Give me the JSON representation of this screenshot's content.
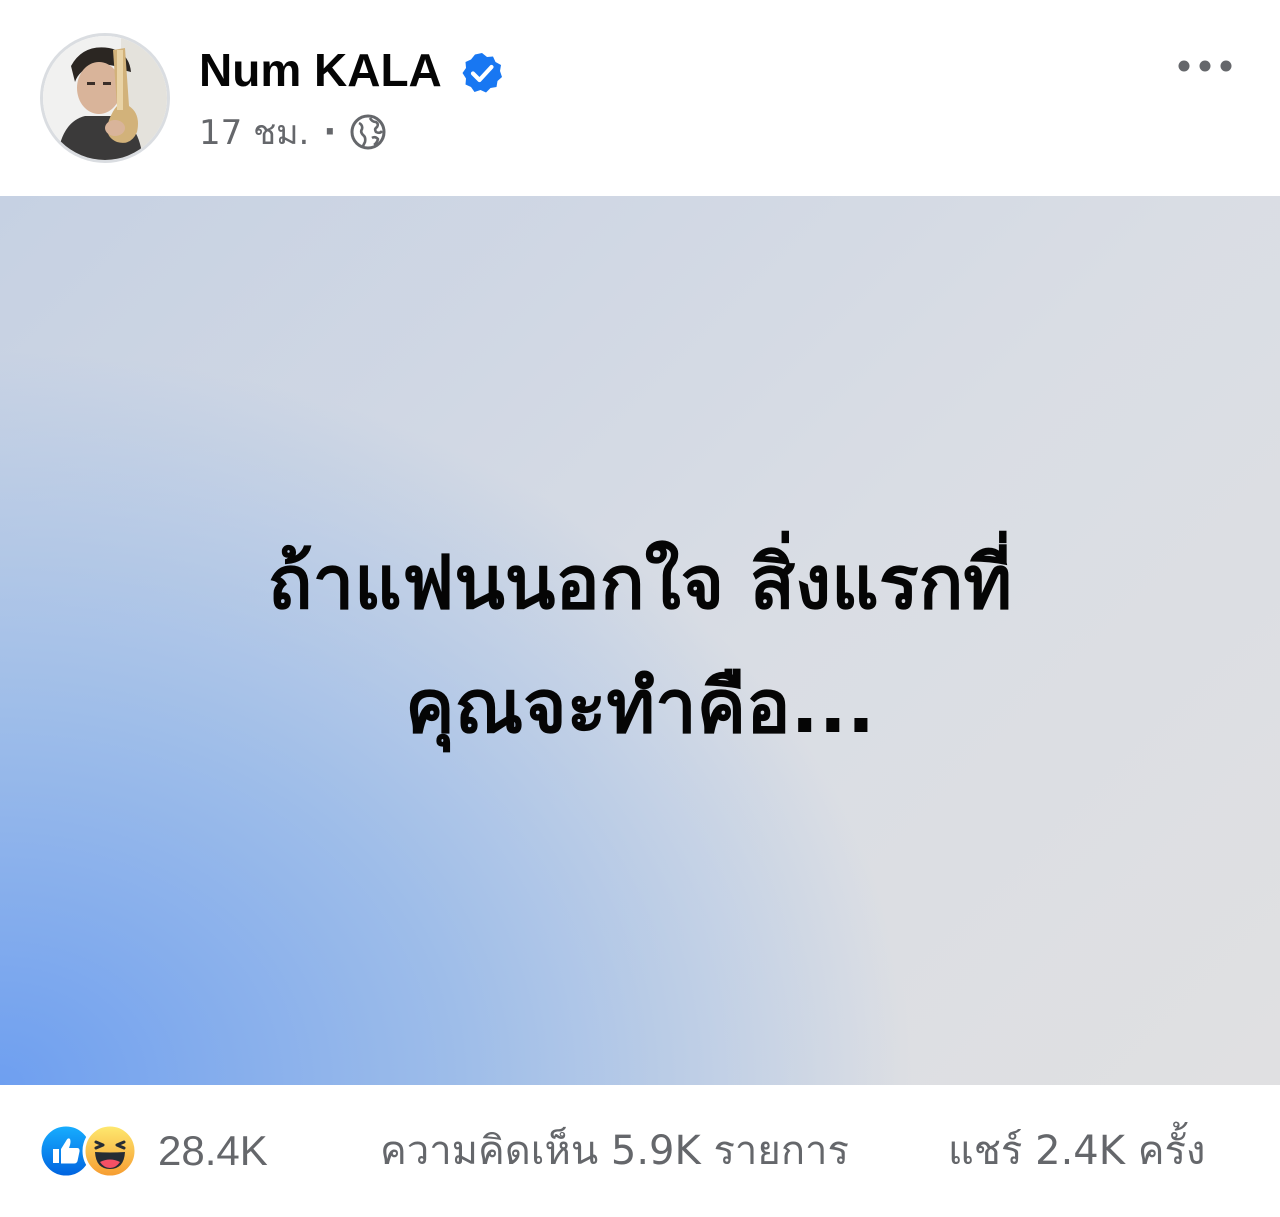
{
  "post": {
    "author": {
      "name": "Num KALA",
      "avatar_icon": "profile-photo",
      "verified_icon": "verified-badge-icon",
      "verified_color": "#1877f2"
    },
    "meta": {
      "time": "17 ชม.",
      "separator": "·",
      "audience_icon": "globe-icon"
    },
    "more_icon": "more-options-icon",
    "content": {
      "lines": [
        "ถ้าแฟนนอกใจ สิ่งแรกที่",
        "คุณจะทำคือ..."
      ],
      "background": {
        "style": "gradient",
        "colors": [
          "#6e9ff0",
          "#c6d1e3",
          "#e0e0e2"
        ]
      }
    },
    "stats": {
      "reactions": [
        "like-icon",
        "haha-icon"
      ],
      "reactions_count": "28.4K",
      "comments": "ความคิดเห็น 5.9K รายการ",
      "shares": "แชร์ 2.4K ครั้ง"
    }
  }
}
